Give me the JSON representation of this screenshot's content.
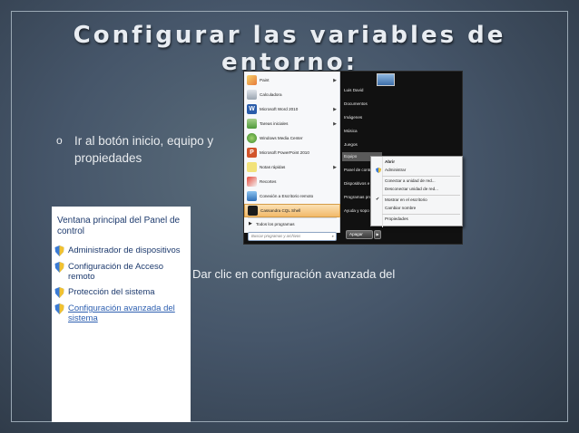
{
  "title": "Configurar las variables de entorno:",
  "bullet": {
    "marker": "o",
    "text": "Ir al botón inicio, equipo y propiedades"
  },
  "caption": "Dar clic en configuración avanzada del",
  "start_menu": {
    "left_items": [
      {
        "label": "Paint",
        "icon": "paint-icon",
        "arrow": true
      },
      {
        "label": "Calculadora",
        "icon": "calculator-icon",
        "arrow": false
      },
      {
        "label": "Microsoft Word 2010",
        "icon": "word-icon",
        "arrow": true
      },
      {
        "label": "Tareas iniciales",
        "icon": "getting-started-icon",
        "arrow": true
      },
      {
        "label": "Windows Media Center",
        "icon": "media-center-icon",
        "arrow": false
      },
      {
        "label": "Microsoft PowerPoint 2010",
        "icon": "powerpoint-icon",
        "arrow": false
      },
      {
        "label": "Notas rápidas",
        "icon": "sticky-notes-icon",
        "arrow": true
      },
      {
        "label": "Recortes",
        "icon": "snipping-icon",
        "arrow": false
      },
      {
        "label": "Conexión a Escritorio remoto",
        "icon": "remote-desktop-icon",
        "arrow": false
      },
      {
        "label": "Cassandra CQL Shell",
        "icon": "cassandra-icon",
        "arrow": false
      }
    ],
    "all_programs": "Todos los programas",
    "search_placeholder": "Buscar programas y archivos",
    "right_items": [
      "Luis David",
      "Documentos",
      "Imágenes",
      "Música",
      "Juegos",
      "Equipo",
      "Panel de contr",
      "Dispositivos e",
      "Programas pre",
      "Ayuda y sopo"
    ],
    "shutdown": "Apagar",
    "context_menu": {
      "items": [
        "Abrir",
        "Administrar",
        "Conectar a unidad de red...",
        "Desconectar unidad de red...",
        "Mostrar en el escritorio",
        "Cambiar nombre",
        "Propiedades"
      ]
    }
  },
  "control_panel": {
    "heading": "Ventana principal del Panel de control",
    "links": [
      "Administrador de dispositivos",
      "Configuración de Acceso remoto",
      "Protección del sistema",
      "Configuración avanzada del sistema"
    ]
  }
}
